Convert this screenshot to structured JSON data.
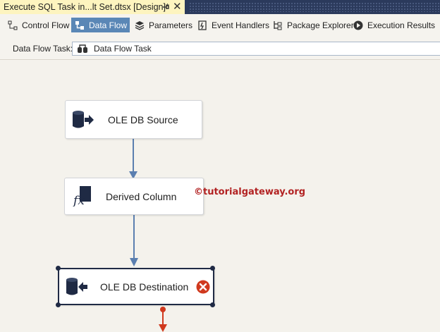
{
  "document_tab": {
    "title": "Execute SQL Task in...lt Set.dtsx [Design]*",
    "pin_icon": "pin-icon",
    "close_glyph": "✕"
  },
  "designer_tabs": [
    {
      "label": "Control Flow",
      "icon": "control-flow-icon",
      "active": false
    },
    {
      "label": "Data Flow",
      "icon": "data-flow-icon",
      "active": true
    },
    {
      "label": "Parameters",
      "icon": "parameters-icon",
      "active": false
    },
    {
      "label": "Event Handlers",
      "icon": "event-handlers-icon",
      "active": false
    },
    {
      "label": "Package Explorer",
      "icon": "package-explorer-icon",
      "active": false
    },
    {
      "label": "Execution Results",
      "icon": "execution-results-icon",
      "active": false
    }
  ],
  "task_selector": {
    "label": "Data Flow Task:",
    "value": "Data Flow Task",
    "icon": "data-flow-task-icon"
  },
  "components": [
    {
      "label": "OLE DB Source",
      "icon": "ole-db-source-icon",
      "status": "ok"
    },
    {
      "label": "Derived Column",
      "icon": "derived-column-icon",
      "status": "ok"
    },
    {
      "label": "OLE DB Destination",
      "icon": "ole-db-destination-icon",
      "status": "error"
    }
  ],
  "watermark": "©tutorialgateway.org",
  "colors": {
    "tab_active_bg": "#5a87b6",
    "document_tab_bg": "#fdf4bf",
    "title_bar_bg": "#2b3a5c",
    "data_path": "#5b7fb0",
    "error_path": "#d0391e",
    "error_badge": "#d0391e"
  }
}
